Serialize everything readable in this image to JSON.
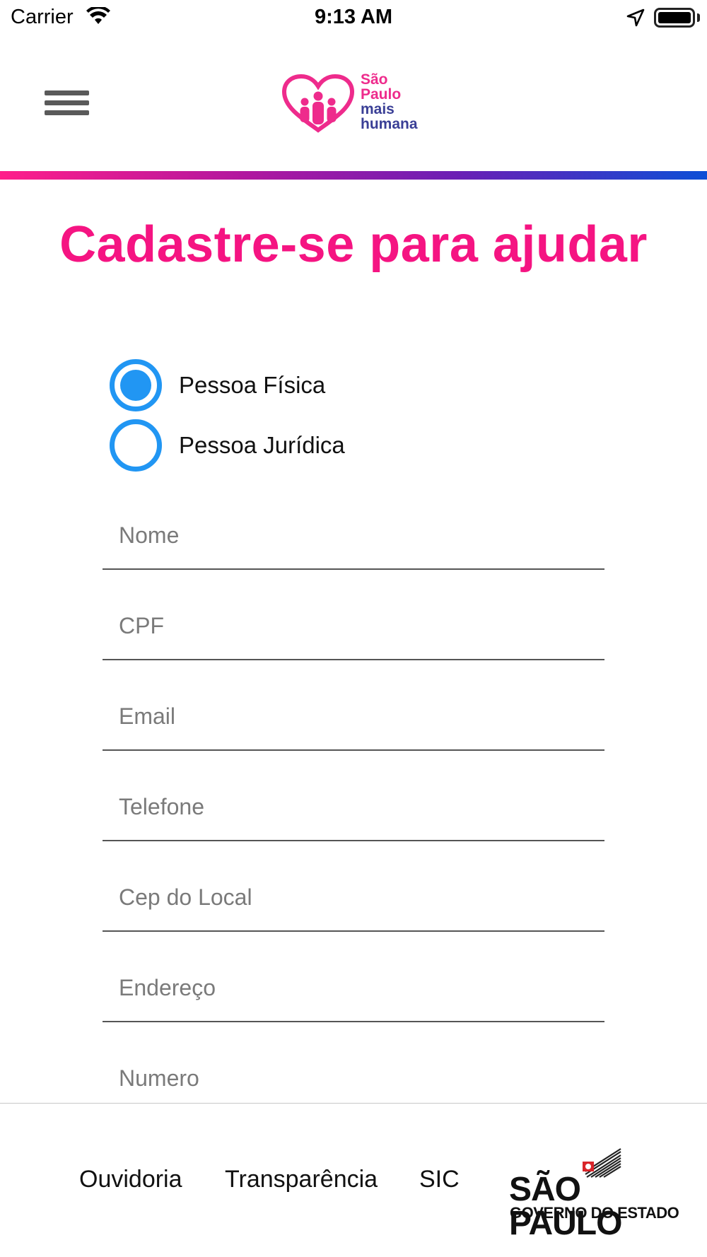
{
  "status_bar": {
    "carrier": "Carrier",
    "time": "9:13 AM",
    "icons": [
      "wifi-icon",
      "location-arrow-icon",
      "battery-icon"
    ]
  },
  "header": {
    "menu_icon": "hamburger-menu-icon",
    "logo": {
      "line1": "São",
      "line2": "Paulo",
      "line3": "mais",
      "line4": "humana",
      "pink": "#ee2b8c",
      "navy": "#3a3f96"
    },
    "gradient_colors": [
      "#ff1e8a",
      "#b0179f",
      "#6a1fb5",
      "#0c4fd6"
    ]
  },
  "main": {
    "title": "Cadastre-se para ajudar",
    "title_color": "#f51482",
    "person_type": {
      "options": [
        {
          "label": "Pessoa Física",
          "selected": true
        },
        {
          "label": "Pessoa Jurídica",
          "selected": false
        }
      ],
      "accent": "#2196f3"
    },
    "fields": [
      {
        "placeholder": "Nome",
        "value": ""
      },
      {
        "placeholder": "CPF",
        "value": ""
      },
      {
        "placeholder": "Email",
        "value": ""
      },
      {
        "placeholder": "Telefone",
        "value": ""
      },
      {
        "placeholder": "Cep do Local",
        "value": ""
      },
      {
        "placeholder": "Endereço",
        "value": ""
      },
      {
        "placeholder": "Numero",
        "value": ""
      }
    ]
  },
  "footer": {
    "links": [
      "Ouvidoria",
      "Transparência",
      "SIC"
    ],
    "gov_logo": {
      "main": "SÃO PAULO",
      "sub": "GOVERNO DO ESTADO"
    }
  }
}
